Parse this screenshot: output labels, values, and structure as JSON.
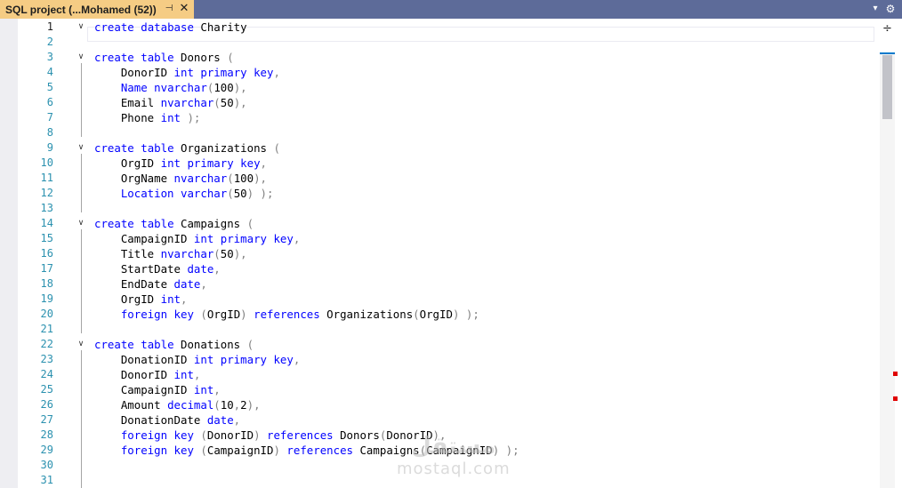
{
  "tab": {
    "title": "SQL project (...Mohamed (52))",
    "pin_glyph": "⊣",
    "close_glyph": "✕",
    "dropdown_glyph": "▾",
    "gear_glyph": "⚙"
  },
  "scroll": {
    "split_glyph": "÷"
  },
  "watermark": {
    "arabic": "مستقل",
    "latin": "mostaql.com"
  },
  "colors": {
    "keyword": "#0000ff",
    "punct": "#808080",
    "line_number": "#2b91af",
    "tab_active": "#f5cc84",
    "tabbar": "#5d6b99"
  },
  "editor": {
    "current_line": 1,
    "lines": [
      {
        "n": "1",
        "fold": "v",
        "tokens": [
          [
            "kw",
            "create"
          ],
          [
            "t",
            " "
          ],
          [
            "kw",
            "database"
          ],
          [
            "t",
            " Charity"
          ]
        ]
      },
      {
        "n": "2",
        "tokens": []
      },
      {
        "n": "3",
        "fold": "v",
        "tokens": [
          [
            "kw",
            "create"
          ],
          [
            "t",
            " "
          ],
          [
            "kw",
            "table"
          ],
          [
            "t",
            " Donors "
          ],
          [
            "gr",
            "("
          ]
        ]
      },
      {
        "n": "4",
        "tokens": [
          [
            "t",
            "    DonorID "
          ],
          [
            "kw",
            "int"
          ],
          [
            "t",
            " "
          ],
          [
            "kw",
            "primary"
          ],
          [
            "t",
            " "
          ],
          [
            "kw",
            "key"
          ],
          [
            "gr",
            ","
          ]
        ]
      },
      {
        "n": "5",
        "tokens": [
          [
            "t",
            "    "
          ],
          [
            "kw",
            "Name"
          ],
          [
            "t",
            " "
          ],
          [
            "kw",
            "nvarchar"
          ],
          [
            "gr",
            "("
          ],
          [
            "t",
            "100"
          ],
          [
            "gr",
            "),"
          ]
        ]
      },
      {
        "n": "6",
        "tokens": [
          [
            "t",
            "    Email "
          ],
          [
            "kw",
            "nvarchar"
          ],
          [
            "gr",
            "("
          ],
          [
            "t",
            "50"
          ],
          [
            "gr",
            "),"
          ]
        ]
      },
      {
        "n": "7",
        "tokens": [
          [
            "t",
            "    Phone "
          ],
          [
            "kw",
            "int"
          ],
          [
            "t",
            " "
          ],
          [
            "gr",
            ");"
          ]
        ]
      },
      {
        "n": "8",
        "tokens": []
      },
      {
        "n": "9",
        "fold": "v",
        "tokens": [
          [
            "kw",
            "create"
          ],
          [
            "t",
            " "
          ],
          [
            "kw",
            "table"
          ],
          [
            "t",
            " Organizations "
          ],
          [
            "gr",
            "("
          ]
        ]
      },
      {
        "n": "10",
        "tokens": [
          [
            "t",
            "    OrgID "
          ],
          [
            "kw",
            "int"
          ],
          [
            "t",
            " "
          ],
          [
            "kw",
            "primary"
          ],
          [
            "t",
            " "
          ],
          [
            "kw",
            "key"
          ],
          [
            "gr",
            ","
          ]
        ]
      },
      {
        "n": "11",
        "tokens": [
          [
            "t",
            "    OrgName "
          ],
          [
            "kw",
            "nvarchar"
          ],
          [
            "gr",
            "("
          ],
          [
            "t",
            "100"
          ],
          [
            "gr",
            "),"
          ]
        ]
      },
      {
        "n": "12",
        "tokens": [
          [
            "t",
            "    "
          ],
          [
            "kw",
            "Location"
          ],
          [
            "t",
            " "
          ],
          [
            "kw",
            "varchar"
          ],
          [
            "gr",
            "("
          ],
          [
            "t",
            "50"
          ],
          [
            "gr",
            ")"
          ],
          [
            "t",
            " "
          ],
          [
            "gr",
            ");"
          ]
        ]
      },
      {
        "n": "13",
        "tokens": []
      },
      {
        "n": "14",
        "fold": "v",
        "tokens": [
          [
            "kw",
            "create"
          ],
          [
            "t",
            " "
          ],
          [
            "kw",
            "table"
          ],
          [
            "t",
            " Campaigns "
          ],
          [
            "gr",
            "("
          ]
        ]
      },
      {
        "n": "15",
        "tokens": [
          [
            "t",
            "    CampaignID "
          ],
          [
            "kw",
            "int"
          ],
          [
            "t",
            " "
          ],
          [
            "kw",
            "primary"
          ],
          [
            "t",
            " "
          ],
          [
            "kw",
            "key"
          ],
          [
            "gr",
            ","
          ]
        ]
      },
      {
        "n": "16",
        "tokens": [
          [
            "t",
            "    Title "
          ],
          [
            "kw",
            "nvarchar"
          ],
          [
            "gr",
            "("
          ],
          [
            "t",
            "50"
          ],
          [
            "gr",
            "),"
          ]
        ]
      },
      {
        "n": "17",
        "tokens": [
          [
            "t",
            "    StartDate "
          ],
          [
            "kw",
            "date"
          ],
          [
            "gr",
            ","
          ]
        ]
      },
      {
        "n": "18",
        "tokens": [
          [
            "t",
            "    EndDate "
          ],
          [
            "kw",
            "date"
          ],
          [
            "gr",
            ","
          ]
        ]
      },
      {
        "n": "19",
        "tokens": [
          [
            "t",
            "    OrgID "
          ],
          [
            "kw",
            "int"
          ],
          [
            "gr",
            ","
          ]
        ]
      },
      {
        "n": "20",
        "tokens": [
          [
            "t",
            "    "
          ],
          [
            "kw",
            "foreign"
          ],
          [
            "t",
            " "
          ],
          [
            "kw",
            "key"
          ],
          [
            "t",
            " "
          ],
          [
            "gr",
            "("
          ],
          [
            "t",
            "OrgID"
          ],
          [
            "gr",
            ")"
          ],
          [
            "t",
            " "
          ],
          [
            "kw",
            "references"
          ],
          [
            "t",
            " Organizations"
          ],
          [
            "gr",
            "("
          ],
          [
            "t",
            "OrgID"
          ],
          [
            "gr",
            ")"
          ],
          [
            "t",
            " "
          ],
          [
            "gr",
            ");"
          ]
        ]
      },
      {
        "n": "21",
        "tokens": []
      },
      {
        "n": "22",
        "fold": "v",
        "tokens": [
          [
            "kw",
            "create"
          ],
          [
            "t",
            " "
          ],
          [
            "kw",
            "table"
          ],
          [
            "t",
            " Donations "
          ],
          [
            "gr",
            "("
          ]
        ]
      },
      {
        "n": "23",
        "tokens": [
          [
            "t",
            "    DonationID "
          ],
          [
            "kw",
            "int"
          ],
          [
            "t",
            " "
          ],
          [
            "kw",
            "primary"
          ],
          [
            "t",
            " "
          ],
          [
            "kw",
            "key"
          ],
          [
            "gr",
            ","
          ]
        ]
      },
      {
        "n": "24",
        "tokens": [
          [
            "t",
            "    DonorID "
          ],
          [
            "kw",
            "int"
          ],
          [
            "gr",
            ","
          ]
        ]
      },
      {
        "n": "25",
        "tokens": [
          [
            "t",
            "    CampaignID "
          ],
          [
            "kw",
            "int"
          ],
          [
            "gr",
            ","
          ]
        ]
      },
      {
        "n": "26",
        "tokens": [
          [
            "t",
            "    Amount "
          ],
          [
            "kw",
            "decimal"
          ],
          [
            "gr",
            "("
          ],
          [
            "t",
            "10"
          ],
          [
            "gr",
            ","
          ],
          [
            "t",
            "2"
          ],
          [
            "gr",
            "),"
          ]
        ]
      },
      {
        "n": "27",
        "tokens": [
          [
            "t",
            "    DonationDate "
          ],
          [
            "kw",
            "date"
          ],
          [
            "gr",
            ","
          ]
        ]
      },
      {
        "n": "28",
        "tokens": [
          [
            "t",
            "    "
          ],
          [
            "kw",
            "foreign"
          ],
          [
            "t",
            " "
          ],
          [
            "kw",
            "key"
          ],
          [
            "t",
            " "
          ],
          [
            "gr",
            "("
          ],
          [
            "t",
            "DonorID"
          ],
          [
            "gr",
            ")"
          ],
          [
            "t",
            " "
          ],
          [
            "kw",
            "references"
          ],
          [
            "t",
            " Donors"
          ],
          [
            "gr",
            "("
          ],
          [
            "t",
            "DonorID"
          ],
          [
            "gr",
            "),"
          ]
        ]
      },
      {
        "n": "29",
        "tokens": [
          [
            "t",
            "    "
          ],
          [
            "kw",
            "foreign"
          ],
          [
            "t",
            " "
          ],
          [
            "kw",
            "key"
          ],
          [
            "t",
            " "
          ],
          [
            "gr",
            "("
          ],
          [
            "t",
            "CampaignID"
          ],
          [
            "gr",
            ")"
          ],
          [
            "t",
            " "
          ],
          [
            "kw",
            "references"
          ],
          [
            "t",
            " Campaigns"
          ],
          [
            "gr",
            "("
          ],
          [
            "t",
            "CampaignID"
          ],
          [
            "gr",
            ")"
          ],
          [
            "t",
            " "
          ],
          [
            "gr",
            ");"
          ]
        ]
      },
      {
        "n": "30",
        "tokens": []
      },
      {
        "n": "31",
        "tokens": []
      }
    ]
  }
}
